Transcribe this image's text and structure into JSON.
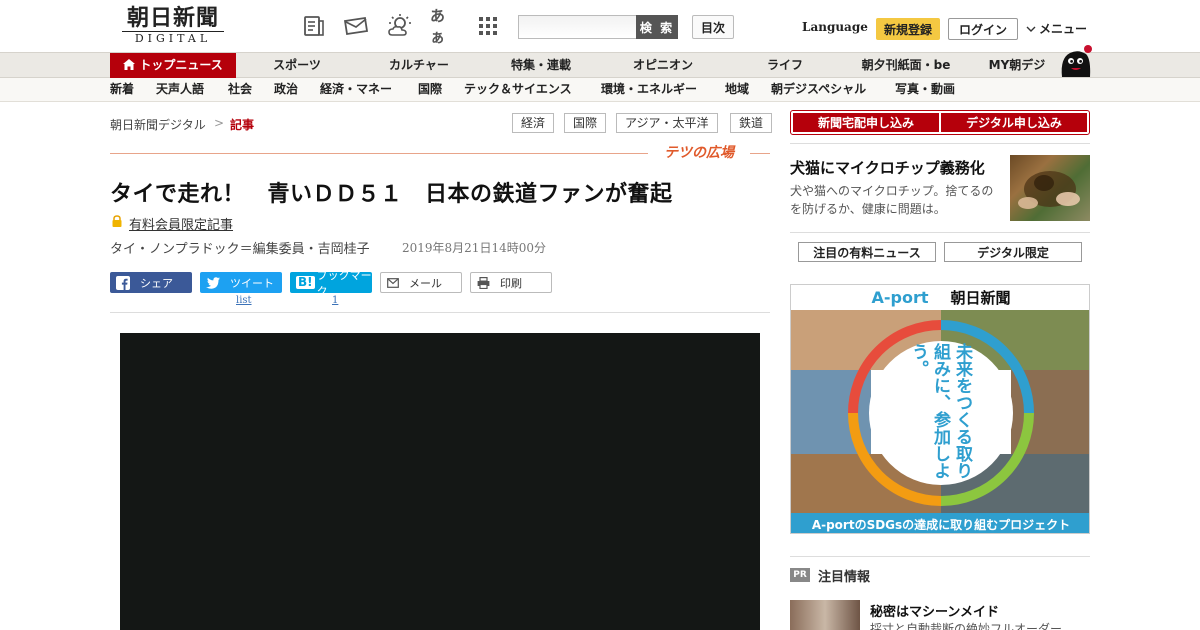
{
  "header": {
    "logo_jp": "朝日新聞",
    "logo_en": "DIGITAL",
    "icons": [
      "newspaper-icon",
      "mail-icon",
      "weather-icon",
      "font-size-icon",
      "grid-icon"
    ],
    "font_size_label": "あぁ",
    "search_placeholder": "",
    "search_button": "検 索",
    "toc_button": "目次",
    "language": "Language",
    "signup": "新規登録",
    "login": "ログイン",
    "menu": "メニュー"
  },
  "nav_main": [
    {
      "label": "トップニュース",
      "active": true
    },
    {
      "label": "スポーツ"
    },
    {
      "label": "カルチャー"
    },
    {
      "label": "特集・連載"
    },
    {
      "label": "オピニオン"
    },
    {
      "label": "ライフ"
    },
    {
      "label": "朝夕刊紙面・be"
    },
    {
      "label": "MY朝デジ"
    }
  ],
  "nav_sub": [
    "新着",
    "天声人語",
    "社会",
    "政治",
    "経済・マネー",
    "国際",
    "テック＆サイエンス",
    "環境・エネルギー",
    "地域",
    "朝デジスペシャル",
    "写真・動画"
  ],
  "breadcrumb": {
    "home": "朝日新聞デジタル",
    "sep": ">",
    "current": "記事"
  },
  "tags": [
    "経済",
    "国際",
    "アジア・太平洋",
    "鉄道"
  ],
  "corner": "テツの広場",
  "article": {
    "title": "タイで走れ！　青いＤＤ５１　日本の鉄道ファンが奮起",
    "member_label": "有料会員限定記事",
    "byline": "タイ・ノンプラドック＝編集委員・吉岡桂子",
    "date": "2019年8月21日14時00分"
  },
  "share": {
    "facebook": "シェア",
    "twitter": "ツイート",
    "hatena": "ブックマーク",
    "mail": "メール",
    "print": "印刷",
    "twitter_count": "list",
    "hatena_count": "1"
  },
  "sidebar": {
    "subscribe_paper": "新聞宅配申し込み",
    "subscribe_digital": "デジタル申し込み",
    "feature_title": "犬猫にマイクロチップ義務化",
    "feature_desc": "犬や猫へのマイクロチップ。捨てるのを防げるか、健康に問題は。",
    "tab_paid": "注目の有料ニュース",
    "tab_digital": "デジタル限定",
    "ad_brand": "A-port",
    "ad_partner": "朝日新聞",
    "ad_slogan": "未来をつくる取り組みに、参加しよう。",
    "ad_caption": "A-portのSDGsの達成に取り組むプロジェクト",
    "pr_badge": "PR",
    "pr_title": "注目情報",
    "pr_item_title": "秘密はマシーンメイド",
    "pr_item_desc": "採寸と自動裁断の絶妙フルオーダー"
  },
  "colors": {
    "brand_red": "#b5000b",
    "corner_orange": "#e05a2b",
    "aport_blue": "#2f9fcf",
    "signup_yellow": "#f4c842"
  }
}
